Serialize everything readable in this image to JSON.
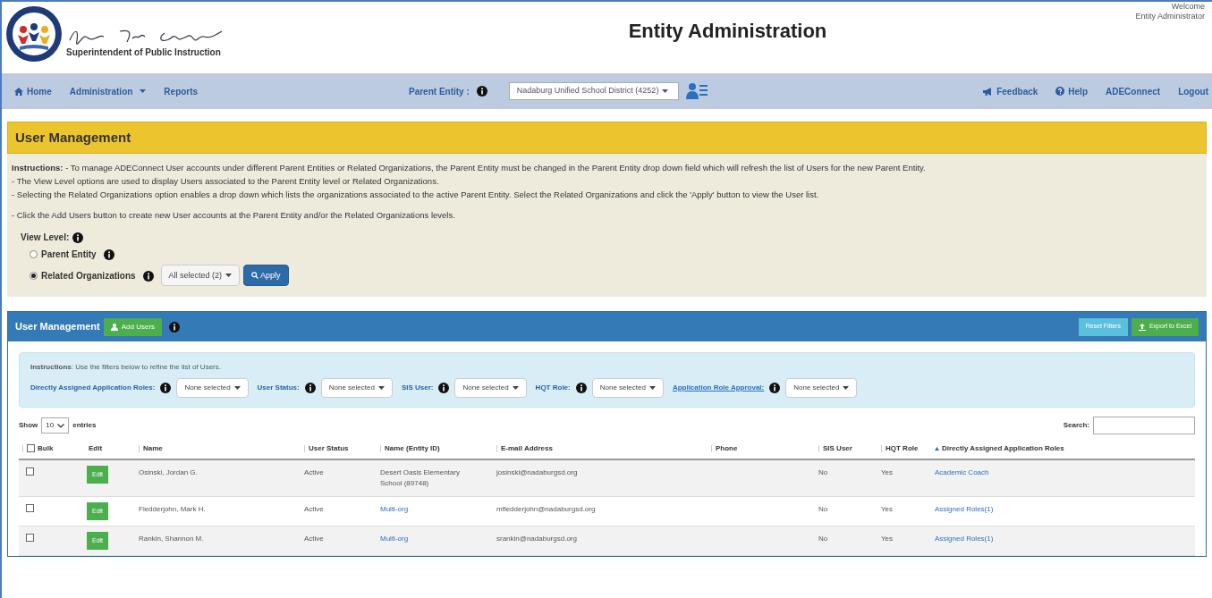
{
  "header": {
    "title": "Entity Administration",
    "subtitle": "Superintendent of Public Instruction",
    "welcome": "Welcome",
    "user": "Entity Administrator"
  },
  "nav": {
    "left": [
      {
        "label": "Home"
      },
      {
        "label": "Administration"
      },
      {
        "label": "Reports"
      }
    ],
    "parent_entity_label": "Parent Entity :",
    "parent_entity_value": "Nadaburg Unified School District (4252)",
    "right": [
      {
        "label": "Feedback"
      },
      {
        "label": "Help"
      },
      {
        "label": "ADEConnect"
      },
      {
        "label": "Logout"
      }
    ]
  },
  "section_title": "User Management",
  "instructions": {
    "lead": "**Instructions:** - To manage ADEConnect User accounts under different Parent Entities or Related Organizations, the Parent Entity must be changed in the Parent Entity drop down field which will refresh the list of Users for the new Parent Entity.",
    "lines": [
      "- The View Level options are used to display Users associated to the Parent Entity level or Related Organizations.",
      "- Selecting the Related Organizations option enables a drop down which lists the organizations associated to the active Parent Entity. Select the Related Organizations and click the 'Apply' button to view the User list."
    ],
    "last": "- Click the Add Users button to create new User accounts at the Parent Entity and/or the Related Organizations levels."
  },
  "view_level": {
    "label": "View Level:",
    "options": [
      {
        "label": "Parent Entity",
        "selected": false
      },
      {
        "label": "Related Organizations",
        "selected": true
      }
    ],
    "dropdown": "All selected (2)",
    "apply": "Apply"
  },
  "panel": {
    "title": "User Management",
    "add": "Add Users",
    "reset": "Reset Filters",
    "export": "Export to Excel"
  },
  "filters": {
    "instructions": "**Instructions**: Use the filters below to refine the list of Users.",
    "items": [
      {
        "label": "Directly Assigned Application Roles:",
        "value": "None selected",
        "kind": "text"
      },
      {
        "label": "User Status:",
        "value": "None selected",
        "kind": "text"
      },
      {
        "label": "SIS User:",
        "value": "None selected",
        "kind": "text"
      },
      {
        "label": "HQT Role:",
        "value": "None selected",
        "kind": "text"
      },
      {
        "label": "Application Role Approval:",
        "value": "None selected",
        "kind": "link"
      }
    ]
  },
  "table": {
    "show": "Show",
    "page_size": "10",
    "entries": "entries",
    "search_label": "Search:",
    "columns": [
      {
        "label": "Bulk",
        "sorted": false
      },
      {
        "label": "Edit",
        "sorted": false
      },
      {
        "label": "Name",
        "sorted": false
      },
      {
        "label": "User Status",
        "sorted": false
      },
      {
        "label": "Name (Entity ID)",
        "sorted": false
      },
      {
        "label": "E-mail Address",
        "sorted": false
      },
      {
        "label": "Phone",
        "sorted": false
      },
      {
        "label": "SIS User",
        "sorted": false
      },
      {
        "label": "HQT Role",
        "sorted": false
      },
      {
        "label": "Directly Assigned Application Roles",
        "sorted": true
      }
    ],
    "bulk_checked": false,
    "rows": [
      {
        "checked": false,
        "edit": "Edit",
        "name": "Osinski, Jordan G.",
        "status": "Active",
        "entity": "Desert Oasis Elementary School (89748)",
        "entity_is_link": false,
        "email": "josinski@nadaburgsd.org",
        "sis": "No",
        "hqt": "Yes",
        "roles": "Academic Coach"
      },
      {
        "checked": false,
        "edit": "Edit",
        "name": "Fledderjohn, Mark H.",
        "status": "Active",
        "entity": "Multi-org",
        "entity_is_link": true,
        "email": "mfledderjohn@nadaburgsd.org",
        "sis": "No",
        "hqt": "Yes",
        "roles": "Assigned Roles(1)"
      },
      {
        "checked": false,
        "edit": "Edit",
        "name": "Rankin, Shannon M.",
        "status": "Active",
        "entity": "Multi-org",
        "entity_is_link": true,
        "email": "srankin@nadaburgsd.org",
        "sis": "No",
        "hqt": "Yes",
        "roles": "Assigned Roles(1)"
      }
    ]
  }
}
